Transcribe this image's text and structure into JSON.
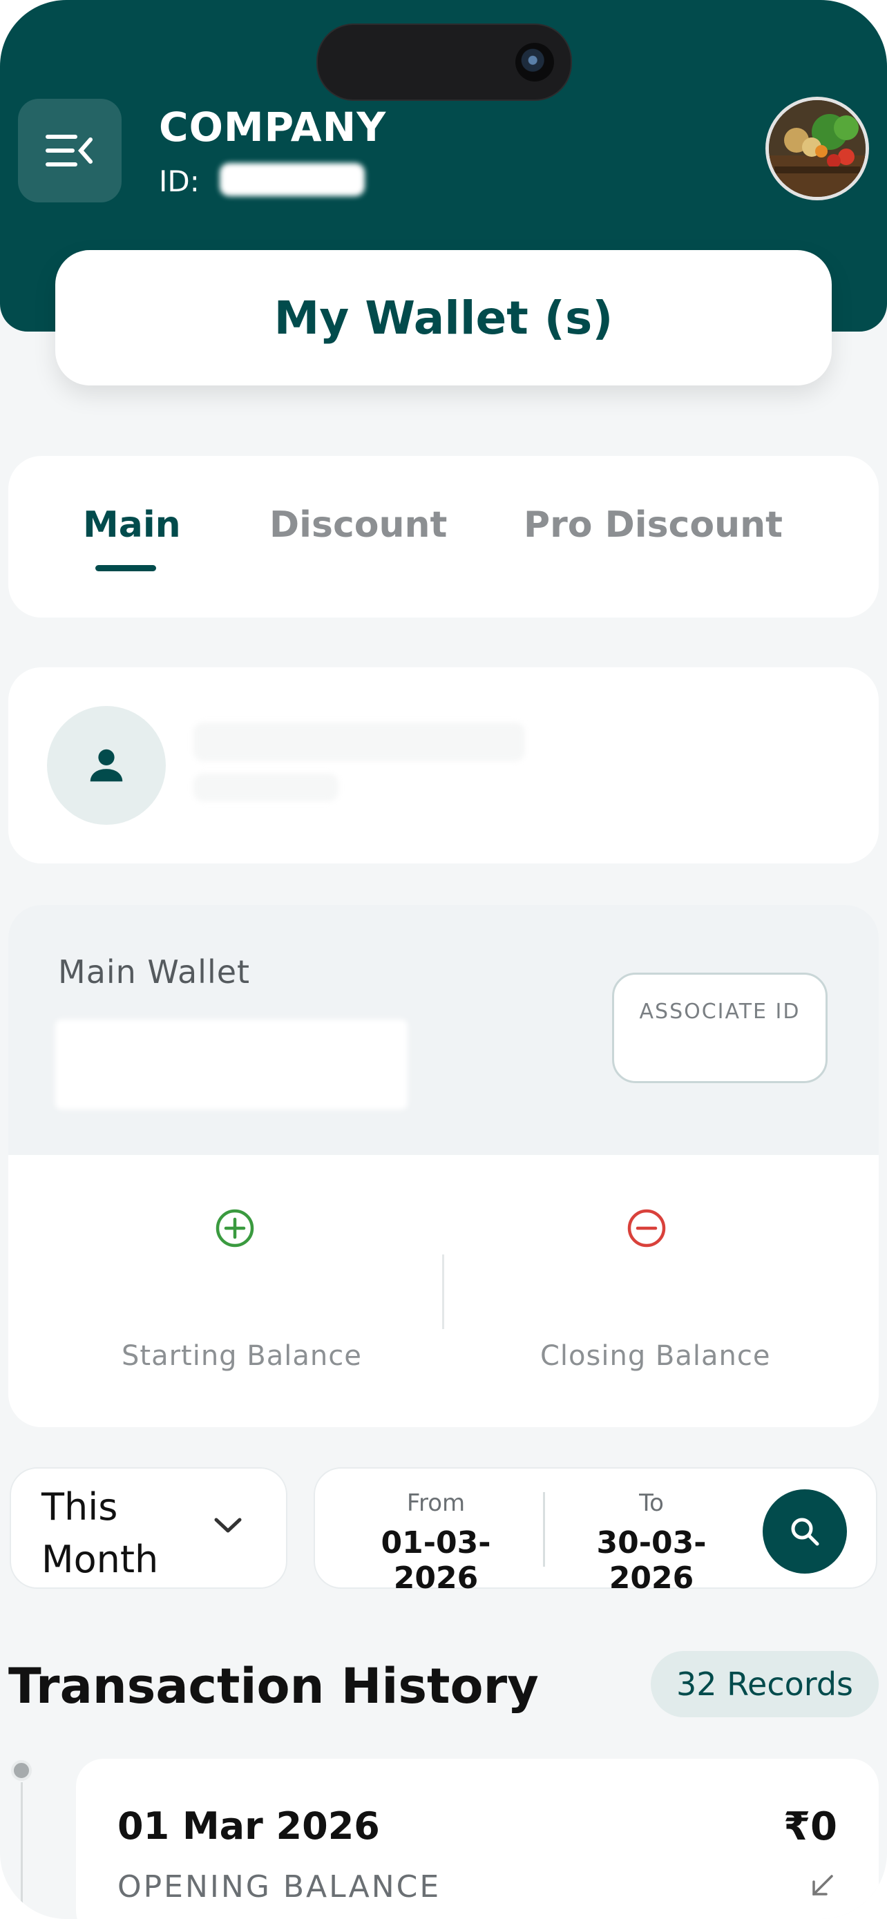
{
  "header": {
    "company_name": "COMPANY",
    "id_label": "ID:",
    "menu_icon": "menu-collapse-icon",
    "avatar": "vegetables-basket-photo"
  },
  "page_title": "My Wallet (s)",
  "tabs": [
    {
      "label": "Main",
      "active": true
    },
    {
      "label": "Discount",
      "active": false
    },
    {
      "label": "Pro Discount",
      "active": false
    }
  ],
  "profile": {
    "icon": "person-icon"
  },
  "wallet": {
    "label": "Main Wallet",
    "associate_label": "ASSOCIATE ID",
    "starting_label": "Starting Balance",
    "closing_label": "Closing Balance",
    "starting_icon": "plus-circle-icon",
    "closing_icon": "minus-circle-icon"
  },
  "filter": {
    "period": "This Month",
    "from_label": "From",
    "from_value": "01-03-2026",
    "to_label": "To",
    "to_value": "30-03-2026"
  },
  "history": {
    "title": "Transaction History",
    "records": "32 Records",
    "items": [
      {
        "date": "01 Mar 2026",
        "type": "OPENING BALANCE",
        "amount": "₹0",
        "direction_icon": "arrow-down-left-icon"
      }
    ]
  },
  "colors": {
    "primary": "#024b4c",
    "background": "#f4f6f7",
    "plus": "#3a9a3f",
    "minus": "#d9413b"
  }
}
